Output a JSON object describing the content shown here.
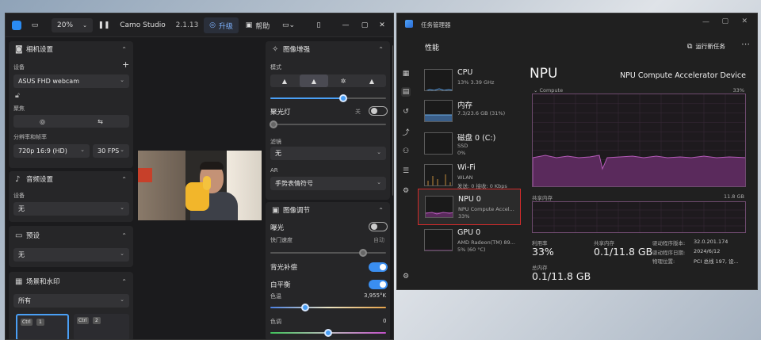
{
  "camo": {
    "zoom": "20%",
    "app_name": "Camo Studio",
    "version": "2.1.13",
    "upgrade_label": "升级",
    "help_label": "帮助",
    "camera_settings": {
      "title": "相机设置",
      "device_label": "设备",
      "device_value": "ASUS FHD webcam",
      "focus_label": "聚焦",
      "resolution_label": "分辨率和帧率",
      "resolution_value": "720p 16:9 (HD)",
      "fps_value": "30 FPS"
    },
    "audio_settings": {
      "title": "音频设置",
      "device_label": "设备",
      "device_value": "无"
    },
    "presets": {
      "title": "预设",
      "value": "无"
    },
    "scenes": {
      "title": "场景和水印",
      "value": "所有",
      "shortcut1": "Ctrl",
      "shortcut1_num": "1",
      "shortcut2": "Ctrl",
      "shortcut2_num": "2"
    },
    "enhance": {
      "title": "图像增强",
      "mode_label": "模式",
      "spotlight_label": "聚光灯",
      "spotlight_state": "关",
      "filter_label": "滤镜",
      "filter_value": "无",
      "ar_label": "AR",
      "ar_value": "手势表情符号"
    },
    "adjust": {
      "title": "图像调节",
      "exposure_label": "曝光",
      "shutter_label": "快门速度",
      "shutter_value": "自动",
      "backlight_label": "背光补偿",
      "wb_label": "白平衡",
      "temp_label": "色温",
      "temp_value": "3,955°K",
      "tint_label": "色调",
      "tint_value": "0"
    },
    "sliders": {
      "mode_level": 0.63,
      "shutter_level": 0.8,
      "temp_level": 0.3,
      "tint_level": 0.5
    }
  },
  "taskmgr": {
    "window_title": "任务管理器",
    "page_title": "性能",
    "run_new_task": "运行新任务",
    "items": [
      {
        "name": "CPU",
        "sub1": "13% 3.39 GHz",
        "sub2": ""
      },
      {
        "name": "内存",
        "sub1": "7.3/23.6 GB (31%)",
        "sub2": ""
      },
      {
        "name": "磁盘 0 (C:)",
        "sub1": "SSD",
        "sub2": "0%"
      },
      {
        "name": "Wi-Fi",
        "sub1": "WLAN",
        "sub2": "发送: 0 接收: 0 Kbps"
      },
      {
        "name": "NPU 0",
        "sub1": "NPU Compute Accel...",
        "sub2": "33%"
      },
      {
        "name": "GPU 0",
        "sub1": "AMD Radeon(TM) 89...",
        "sub2": "5% (60 °C)"
      }
    ],
    "detail": {
      "title": "NPU",
      "device_name": "NPU Compute Accelerator Device",
      "graph1_label": "Compute",
      "graph1_max": "33%",
      "graph2_label": "共享内存",
      "graph2_max": "11.8 GB",
      "util_label": "利用率",
      "util_value": "33%",
      "shared_label": "共享内存",
      "shared_value": "0.1/11.8 GB",
      "total_label": "总内存",
      "total_value": "0.1/11.8 GB",
      "driver_version_label": "驱动程序版本:",
      "driver_version_value": "32.0.201.174",
      "driver_date_label": "驱动程序日期:",
      "driver_date_value": "2024/6/12",
      "location_label": "物理位置:",
      "location_value": "PCI 总线 197, 设..."
    },
    "colors": {
      "accent": "#9c4fa0",
      "highlight": "#d22b2b"
    }
  }
}
